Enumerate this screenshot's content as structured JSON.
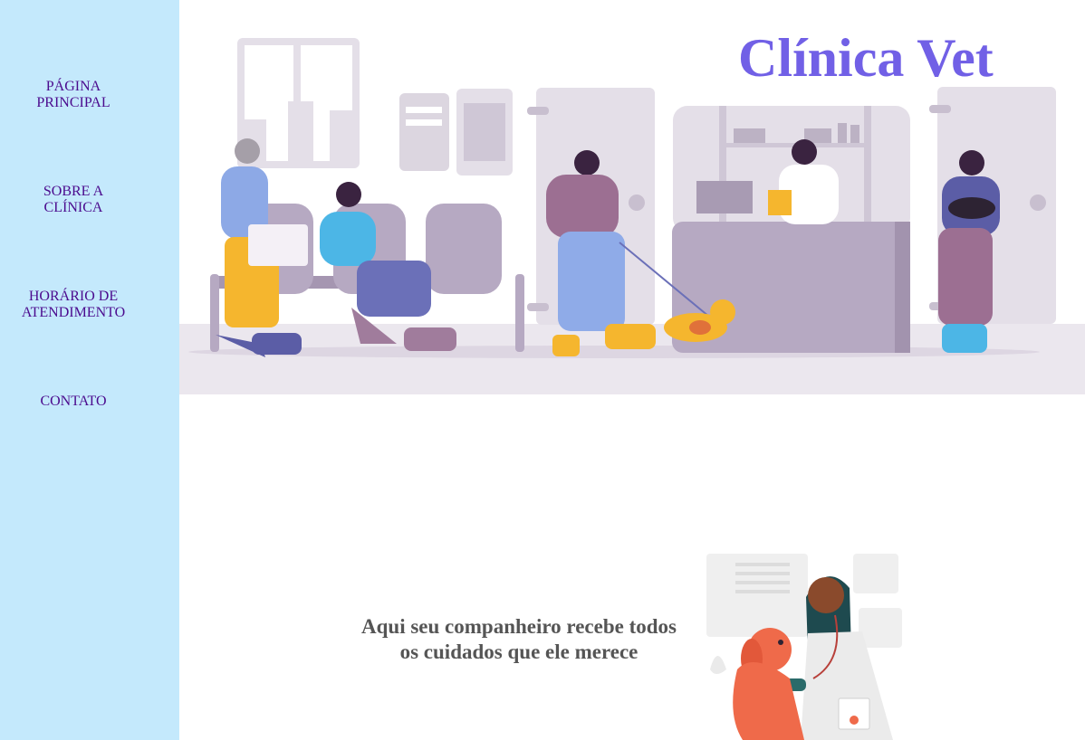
{
  "nav": {
    "items": [
      {
        "line1": "PÁGINA",
        "line2": "PRINCIPAL"
      },
      {
        "line1": "SOBRE A",
        "line2": "CLÍNICA"
      },
      {
        "line1": "HORÁRIO DE",
        "line2": "ATENDIMENTO"
      },
      {
        "line1": "CONTATO",
        "line2": ""
      }
    ]
  },
  "hero": {
    "title": "Clínica Vet"
  },
  "main": {
    "tagline_line1": "Aqui seu companheiro recebe todos",
    "tagline_line2": "os cuidados que ele merece"
  },
  "colors": {
    "sidebar_bg": "#c4e9fc",
    "nav_link": "#4b0b8e",
    "title": "#7160e6",
    "tagline": "#555555"
  }
}
